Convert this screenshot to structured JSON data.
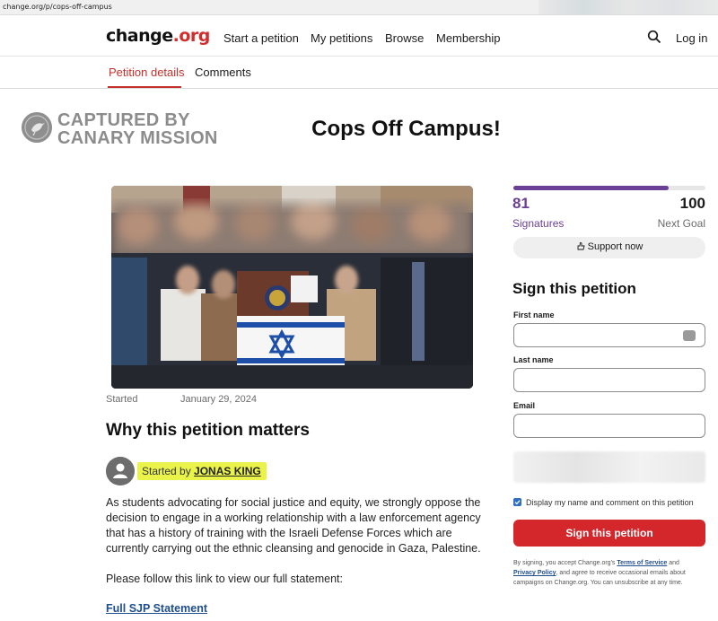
{
  "browser": {
    "url": "change.org/p/cops-off-campus"
  },
  "nav": {
    "logo_text": "change",
    "logo_dot": ".org",
    "links": [
      "Start a petition",
      "My petitions",
      "Browse",
      "Membership"
    ],
    "login": "Log in"
  },
  "tabs": [
    "Petition details",
    "Comments"
  ],
  "watermark": {
    "line1": "CAPTURED BY",
    "line2": "CANARY MISSION"
  },
  "petition": {
    "title": "Cops Off Campus!",
    "started_label": "Started",
    "started_date": "January 29, 2024",
    "why_heading": "Why this petition matters",
    "started_by_prefix": "Started by",
    "author": "JONAS KING",
    "body": "As students advocating for social justice and equity, we strongly oppose the decision to engage in a working relationship with a law enforcement agency that has a history of training with the Israeli Defense Forces which are currently carrying out the ethnic cleansing and genocide in Gaza, Palestine.",
    "follow": "Please follow this link to view our full statement:",
    "link": "Full SJP Statement"
  },
  "signatures": {
    "count": "81",
    "goal": "100",
    "progress_fraction": 0.81,
    "count_label": "Signatures",
    "goal_label": "Next Goal",
    "support_button": "Support now"
  },
  "form": {
    "heading": "Sign this petition",
    "first_name_label": "First name",
    "last_name_label": "Last name",
    "email_label": "Email",
    "display_checkbox_label": "Display my name and comment on this petition",
    "display_checked": true,
    "submit": "Sign this petition",
    "legal_prefix": "By signing, you accept Change.org's",
    "terms": "Terms of Service",
    "legal_and": "and",
    "privacy": "Privacy Policy",
    "legal_suffix": ", and agree to receive occasional emails about campaigns on Change.org. You can unsubscribe at any time."
  },
  "colors": {
    "accent_red": "#d4272c",
    "progress_purple": "#6a3f95",
    "highlight": "#eaf34a"
  },
  "icons": [
    "search-icon",
    "support-hand-icon",
    "autofill-icon",
    "user-avatar-icon",
    "canary-bird-icon"
  ]
}
